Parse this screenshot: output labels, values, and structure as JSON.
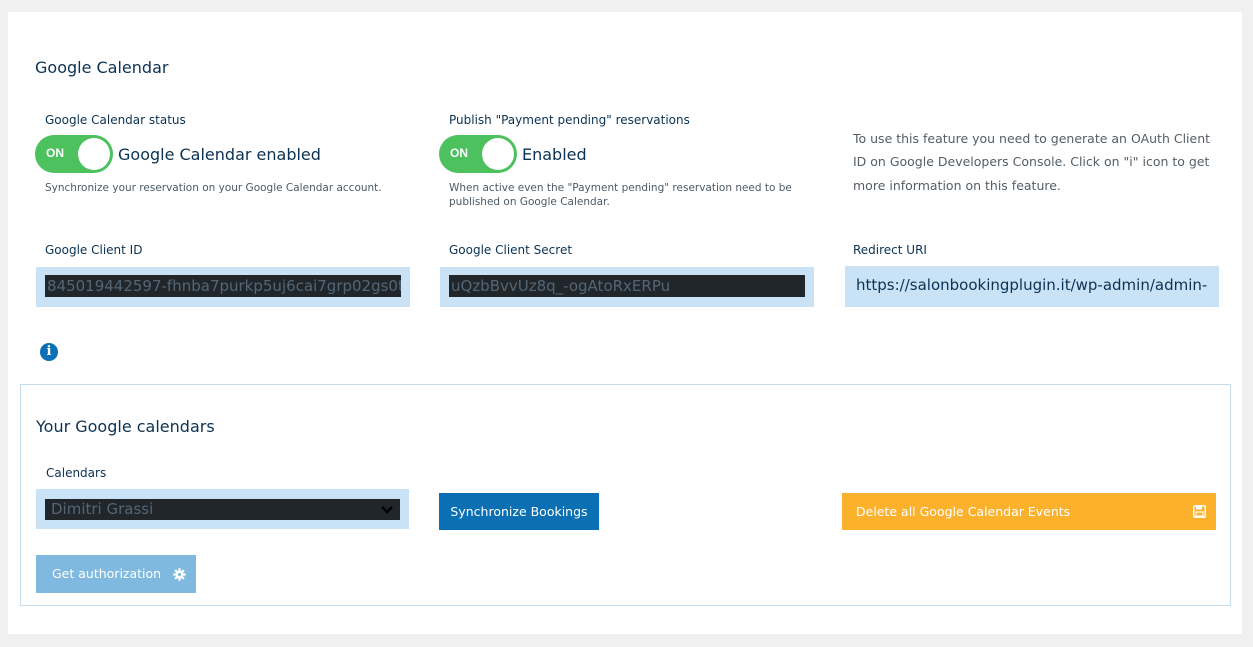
{
  "google_calendar": {
    "title": "Google Calendar",
    "status": {
      "label": "Google Calendar status",
      "toggle_state": "ON",
      "toggle_text": "Google Calendar enabled",
      "help": "Synchronize your reservation on your Google Calendar account."
    },
    "publish_pending": {
      "label": "Publish \"Payment pending\" reservations",
      "toggle_state": "ON",
      "toggle_text": "Enabled",
      "help_line1": "When active even the \"Payment pending\" reservation need to be",
      "help_line2": "published on Google Calendar."
    },
    "info": {
      "line1": "To use this feature you need to generate an OAuth Client",
      "line2": "ID on Google Developers Console. Click on \"i\" icon to get",
      "line3": "more information on this feature."
    },
    "client_id": {
      "label": "Google Client ID",
      "value": "845019442597-fhnba7purkp5uj6cai7grp02gs0t"
    },
    "client_secret": {
      "label": "Google Client Secret",
      "value": "uQzbBvvUz8q_-ogAtoRxERPu"
    },
    "redirect_uri": {
      "label": "Redirect URI",
      "value": "https://salonbookingplugin.it/wp-admin/admin-"
    },
    "info_icon": "info-icon"
  },
  "your_calendars": {
    "title": "Your Google calendars",
    "calendars_label": "Calendars",
    "selected_calendar": "Dimitri Grassi",
    "sync_button": "Synchronize Bookings",
    "delete_button": "Delete all Google Calendar Events",
    "auth_button": "Get authorization"
  },
  "colors": {
    "toggle_on": "#4ec15f",
    "primary": "#0b6fb3",
    "warning": "#fcb12c",
    "auth": "#7fb9df",
    "input_bg": "#c9e2f5"
  }
}
